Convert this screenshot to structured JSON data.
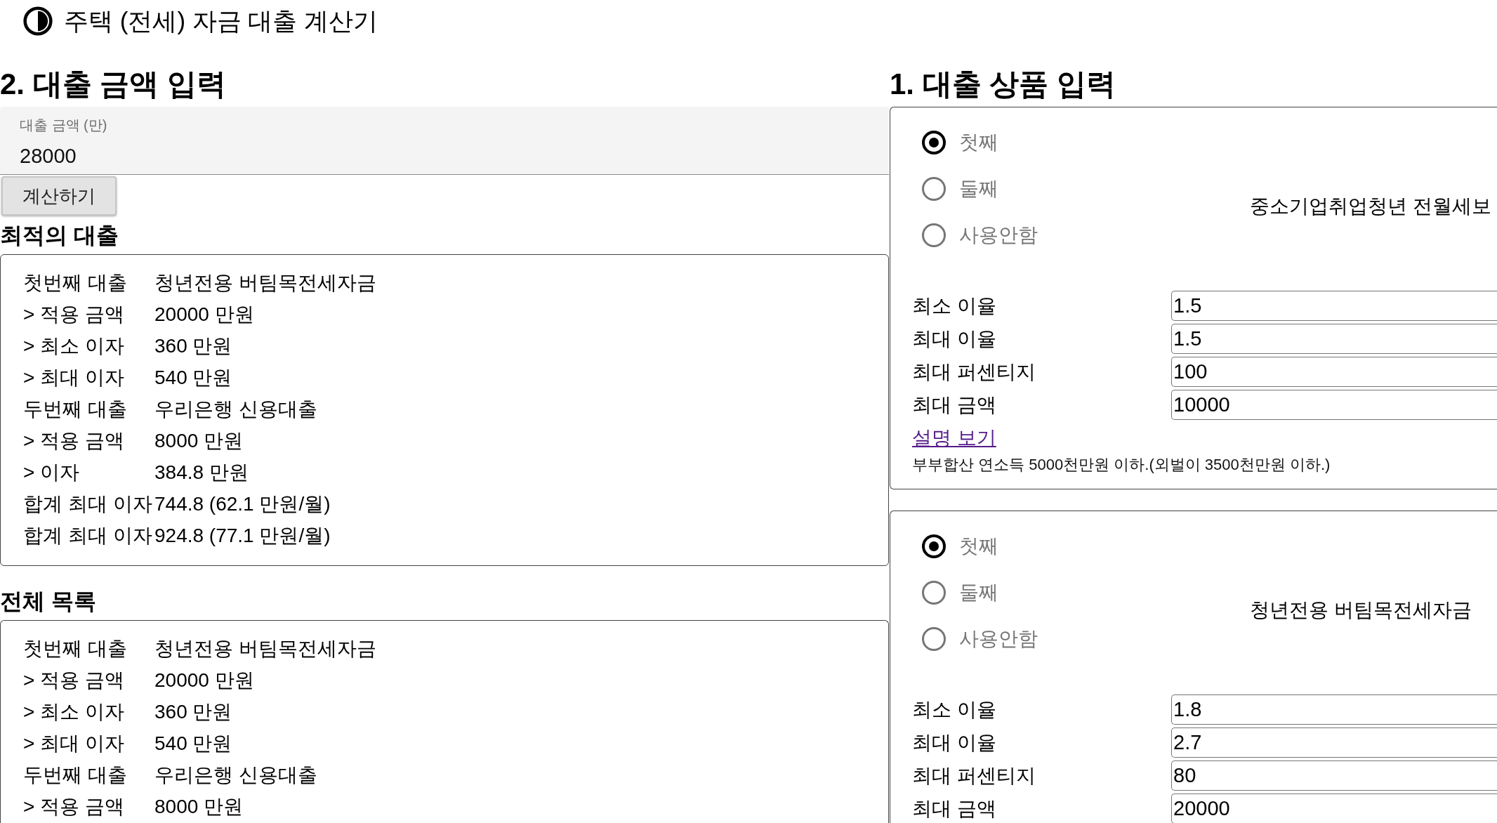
{
  "header": {
    "title": "주택 (전세) 자금 대출 계산기"
  },
  "loan_amount": {
    "heading": "2. 대출 금액 입력",
    "amount_field": {
      "label": "대출 금액 (만)",
      "value": "28000"
    },
    "calculate_button": "계산하기",
    "best_loans": {
      "heading": "최적의 대출",
      "rows": [
        {
          "label": "첫번째 대출",
          "value": "청년전용 버팀목전세자금"
        },
        {
          "label": "> 적용 금액",
          "value": "20000 만원"
        },
        {
          "label": "> 최소 이자",
          "value": "360 만원"
        },
        {
          "label": "> 최대 이자",
          "value": "540 만원"
        },
        {
          "label": "두번째 대출",
          "value": "우리은행 신용대출"
        },
        {
          "label": "> 적용 금액",
          "value": "8000 만원"
        },
        {
          "label": "> 이자",
          "value": "384.8 만원"
        },
        {
          "label": "합계 최대 이자",
          "value": "744.8 (62.1 만원/월)"
        },
        {
          "label": "합계 최대 이자",
          "value": "924.8 (77.1 만원/월)"
        }
      ]
    },
    "all_loans": {
      "heading": "전체 목록",
      "rows": [
        {
          "label": "첫번째 대출",
          "value": "청년전용 버팀목전세자금"
        },
        {
          "label": "> 적용 금액",
          "value": "20000 만원"
        },
        {
          "label": "> 최소 이자",
          "value": "360 만원"
        },
        {
          "label": "> 최대 이자",
          "value": "540 만원"
        },
        {
          "label": "두번째 대출",
          "value": "우리은행 신용대출"
        },
        {
          "label": "> 적용 금액",
          "value": "8000 만원"
        }
      ]
    }
  },
  "loan_products": {
    "heading": "1. 대출 상품 입력",
    "products": [
      {
        "options": [
          {
            "label": "첫째",
            "selected": true
          },
          {
            "label": "둘째",
            "selected": false
          },
          {
            "label": "사용안함",
            "selected": false
          }
        ],
        "name": "중소기업취업청년 전월세보",
        "fields": [
          {
            "label": "최소 이율",
            "value": "1.5"
          },
          {
            "label": "최대 이율",
            "value": "1.5"
          },
          {
            "label": "최대 퍼센티지",
            "value": "100"
          },
          {
            "label": "최대 금액",
            "value": "10000"
          }
        ],
        "link": "설명 보기",
        "note": "부부합산 연소득 5000천만원 이하.(외벌이 3500천만원 이하.)"
      },
      {
        "options": [
          {
            "label": "첫째",
            "selected": true
          },
          {
            "label": "둘째",
            "selected": false
          },
          {
            "label": "사용안함",
            "selected": false
          }
        ],
        "name": "청년전용 버팀목전세자금",
        "fields": [
          {
            "label": "최소 이율",
            "value": "1.8"
          },
          {
            "label": "최대 이율",
            "value": "2.7"
          },
          {
            "label": "최대 퍼센티지",
            "value": "80"
          },
          {
            "label": "최대 금액",
            "value": "20000"
          }
        ]
      }
    ]
  }
}
